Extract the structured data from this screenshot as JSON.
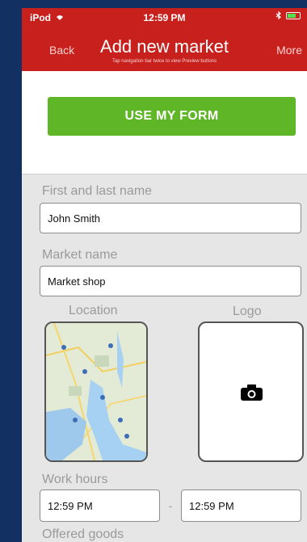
{
  "status_bar": {
    "carrier": "iPod",
    "time": "12:59 PM"
  },
  "nav": {
    "back_label": "Back",
    "title": "Add new market",
    "subtitle": "Tap navigation bar twice to view Preview buttons",
    "more_label": "More"
  },
  "form_button_label": "USE MY FORM",
  "fields": {
    "name_label": "First and last name",
    "name_value": "John Smith",
    "market_label": "Market name",
    "market_value": "Market shop",
    "location_label": "Location",
    "logo_label": "Logo",
    "work_hours_label": "Work hours",
    "start_time": "12:59 PM",
    "separator": "-",
    "end_time": "12:59 PM",
    "offered_goods_label": "Offered goods"
  },
  "colors": {
    "nav_red": "#c8201d",
    "accent_green": "#5fb728",
    "background_blue": "#123062"
  },
  "icons": [
    "wifi-icon",
    "bluetooth-icon",
    "battery-icon",
    "camera-icon",
    "map-thumbnail"
  ]
}
